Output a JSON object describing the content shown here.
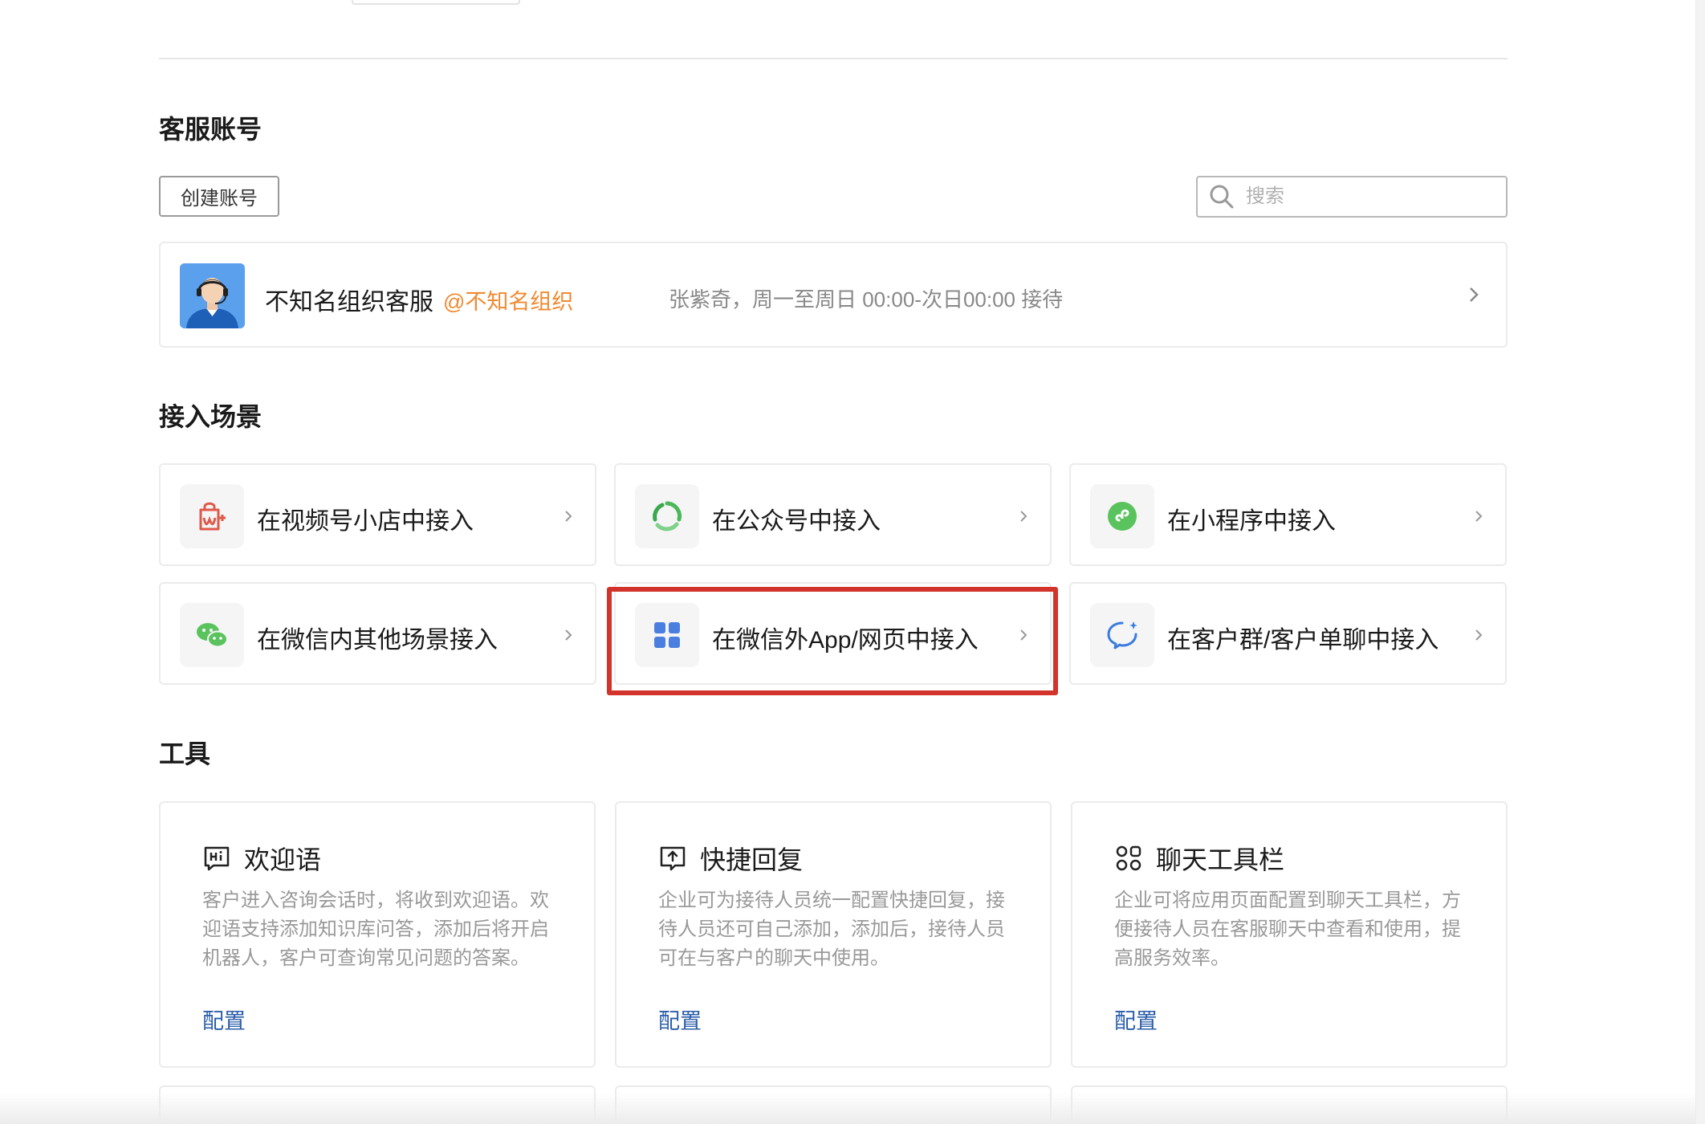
{
  "account_section": {
    "title": "客服账号",
    "create_button": "创建账号",
    "search_placeholder": "搜索",
    "account": {
      "name": "不知名组织客服",
      "org": "@不知名组织",
      "schedule": "张紫奇，周一至周日 00:00-次日00:00 接待"
    }
  },
  "scenes_section": {
    "title": "接入场景",
    "items": [
      {
        "label": "在视频号小店中接入",
        "icon": "shop-bag-icon"
      },
      {
        "label": "在公众号中接入",
        "icon": "official-account-icon"
      },
      {
        "label": "在小程序中接入",
        "icon": "mini-program-icon"
      },
      {
        "label": "在微信内其他场景接入",
        "icon": "wechat-icon"
      },
      {
        "label": "在微信外App/网页中接入",
        "icon": "app-grid-icon"
      },
      {
        "label": "在客户群/客户单聊中接入",
        "icon": "chat-bubble-icon"
      }
    ]
  },
  "tools_section": {
    "title": "工具",
    "items": [
      {
        "title": "欢迎语",
        "icon": "hi-message-icon",
        "desc": "客户进入咨询会话时，将收到欢迎语。欢迎语支持添加知识库问答，添加后将开启机器人，客户可查询常见问题的答案。",
        "action": "配置"
      },
      {
        "title": "快捷回复",
        "icon": "quick-reply-icon",
        "desc": "企业可为接待人员统一配置快捷回复，接待人员还可自己添加，添加后，接待人员可在与客户的聊天中使用。",
        "action": "配置"
      },
      {
        "title": "聊天工具栏",
        "icon": "toolbar-grid-icon",
        "desc": "企业可将应用页面配置到聊天工具栏，方便接待人员在客服聊天中查看和使用，提高服务效率。",
        "action": "配置"
      }
    ]
  },
  "colors": {
    "accent_link": "#2b5ea9",
    "org_tag": "#f08a30",
    "highlight_box": "#d2332a",
    "wechat_green": "#5ac35e"
  }
}
